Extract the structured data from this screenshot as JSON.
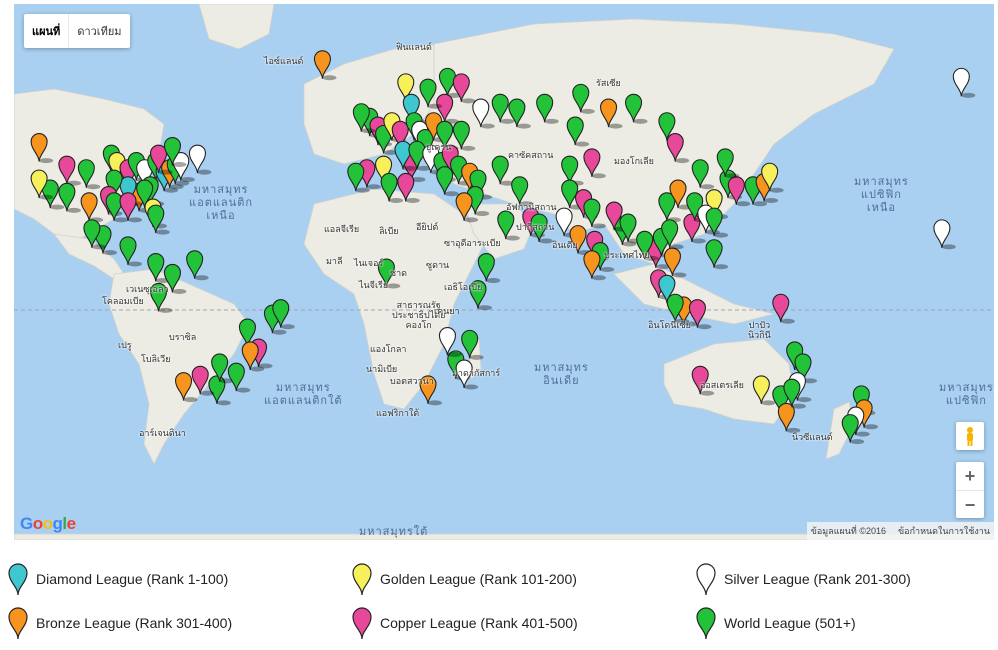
{
  "map_controls": {
    "map_type_map": "แผนที่",
    "map_type_satellite": "ดาวเทียม",
    "zoom_in": "+",
    "zoom_out": "−"
  },
  "branding": {
    "google_logo": "Google",
    "attribution": "ข้อมูลแผนที่ ©2016",
    "terms": "ข้อกำหนดในการใช้งาน"
  },
  "ocean_labels": {
    "north_atlantic": "มหาสมุทร\nแอตแลนติก\nเหนือ",
    "south_atlantic": "มหาสมุทร\nแอตแลนติกใต้",
    "north_pacific": "มหาสมุทร\nแปซิฟิก\nเหนือ",
    "south_pacific": "มหาสมุทร\nแปซิฟิก",
    "indian": "มหาสมุทร\nอินเดีย",
    "southern": "มหาสมุทรใต้"
  },
  "place_labels": {
    "iceland": "ไอซ์แลนด์",
    "finland": "ฟินแลนด์",
    "russia": "รัสเซีย",
    "ukraine": "ยูเครน",
    "kazakhstan": "คาซัคสถาน",
    "mongolia": "มองโกเลีย",
    "afghanistan": "อัฟกานิสถาน",
    "pakistan": "ปากีสถาน",
    "india": "อินเดีย",
    "algeria": "แอลจีเรีย",
    "libya": "ลิเบีย",
    "egypt": "อียิปต์",
    "saudi": "ซาอุดีอาระเบีย",
    "mali": "มาลี",
    "niger": "ไนเจอร์",
    "chad": "ชาด",
    "sudan": "ซูดาน",
    "nigeria": "ไนจีเรีย",
    "ethiopia": "เอธิโอเปีย",
    "drc": "สาธารณรัฐ\nประชาธิปไตย\nคองโก",
    "kenya": "เคนยา",
    "angola": "แองโกลา",
    "namibia": "นามิเบีย",
    "botswana": "บอตสวานา",
    "madagascar": "มาดากัสการ์",
    "south_africa": "แอฟริกาใต้",
    "venezuela": "เวเนซุเอลา",
    "colombia": "โคลอมเบีย",
    "peru": "เปรู",
    "brazil": "บราซิล",
    "bolivia": "โบลิเวีย",
    "argentina": "อาร์เจนตินา",
    "indonesia": "อินโดนีเซีย",
    "png": "ปาปัว\nนิวกินี",
    "australia": "ออสเตรเลีย",
    "new_zealand": "นิวซีแลนด์",
    "thailand": "ประเทศไทย"
  },
  "legend": [
    {
      "label": "Diamond League (Rank 1-100)",
      "color": "#3fc7d0"
    },
    {
      "label": "Golden League (Rank 101-200)",
      "color": "#f8f05a"
    },
    {
      "label": "Silver League (Rank 201-300)",
      "color": "#ffffff"
    },
    {
      "label": "Bronze League (Rank 301-400)",
      "color": "#f7941d"
    },
    {
      "label": "Copper League (Rank 401-500)",
      "color": "#e8489a"
    },
    {
      "label": "World League (501+)",
      "color": "#22c339"
    }
  ],
  "markers": [
    {
      "lon": -96,
      "lat": 44,
      "league": 5
    },
    {
      "lon": -94,
      "lat": 42,
      "league": 1
    },
    {
      "lon": -90,
      "lat": 40,
      "league": 4
    },
    {
      "lon": -87,
      "lat": 42,
      "league": 5
    },
    {
      "lon": -84,
      "lat": 40,
      "league": 2
    },
    {
      "lon": -80,
      "lat": 42,
      "league": 5
    },
    {
      "lon": -77,
      "lat": 39,
      "league": 0
    },
    {
      "lon": -75,
      "lat": 40,
      "league": 3
    },
    {
      "lon": -73,
      "lat": 41,
      "league": 5
    },
    {
      "lon": -71,
      "lat": 42,
      "league": 2
    },
    {
      "lon": -79,
      "lat": 44,
      "league": 4
    },
    {
      "lon": -74,
      "lat": 46,
      "league": 5
    },
    {
      "lon": -65,
      "lat": 44,
      "league": 2
    },
    {
      "lon": -82,
      "lat": 35,
      "league": 5
    },
    {
      "lon": -86,
      "lat": 33,
      "league": 3
    },
    {
      "lon": -90,
      "lat": 35,
      "league": 0
    },
    {
      "lon": -95,
      "lat": 37,
      "league": 5
    },
    {
      "lon": -97,
      "lat": 32,
      "league": 4
    },
    {
      "lon": -95,
      "lat": 30,
      "league": 5
    },
    {
      "lon": -90,
      "lat": 30,
      "league": 4
    },
    {
      "lon": -84,
      "lat": 34,
      "league": 5
    },
    {
      "lon": -81,
      "lat": 28,
      "league": 1
    },
    {
      "lon": -80,
      "lat": 26,
      "league": 5
    },
    {
      "lon": -105,
      "lat": 40,
      "league": 5
    },
    {
      "lon": -112,
      "lat": 41,
      "league": 4
    },
    {
      "lon": -118,
      "lat": 34,
      "league": 5
    },
    {
      "lon": -122,
      "lat": 37,
      "league": 1
    },
    {
      "lon": -122,
      "lat": 47,
      "league": 3
    },
    {
      "lon": -112,
      "lat": 33,
      "league": 5
    },
    {
      "lon": -104,
      "lat": 30,
      "league": 3
    },
    {
      "lon": -99,
      "lat": 19,
      "league": 5
    },
    {
      "lon": -103,
      "lat": 21,
      "league": 5
    },
    {
      "lon": -90,
      "lat": 15,
      "league": 5
    },
    {
      "lon": -80,
      "lat": 9,
      "league": 5
    },
    {
      "lon": -74,
      "lat": 5,
      "league": 5
    },
    {
      "lon": -66,
      "lat": 10,
      "league": 5
    },
    {
      "lon": -79,
      "lat": -2,
      "league": 5
    },
    {
      "lon": -47,
      "lat": -15,
      "league": 5
    },
    {
      "lon": -43,
      "lat": -22,
      "league": 4
    },
    {
      "lon": -46,
      "lat": -23,
      "league": 3
    },
    {
      "lon": -38,
      "lat": -10,
      "league": 5
    },
    {
      "lon": -58,
      "lat": -34,
      "league": 5
    },
    {
      "lon": -64,
      "lat": -31,
      "league": 4
    },
    {
      "lon": -70,
      "lat": -33,
      "league": 3
    },
    {
      "lon": -57,
      "lat": -27,
      "league": 5
    },
    {
      "lon": -51,
      "lat": -30,
      "league": 5
    },
    {
      "lon": -35,
      "lat": -8,
      "league": 5
    },
    {
      "lon": -20,
      "lat": 64,
      "league": 3
    },
    {
      "lon": 10,
      "lat": 60,
      "league": 1
    },
    {
      "lon": 25,
      "lat": 61,
      "league": 5
    },
    {
      "lon": 24,
      "lat": 56,
      "league": 4
    },
    {
      "lon": 18,
      "lat": 59,
      "league": 5
    },
    {
      "lon": 12,
      "lat": 56,
      "league": 0
    },
    {
      "lon": -3,
      "lat": 53,
      "league": 5
    },
    {
      "lon": 0,
      "lat": 51,
      "league": 4
    },
    {
      "lon": -6,
      "lat": 54,
      "league": 5
    },
    {
      "lon": 2,
      "lat": 49,
      "league": 5
    },
    {
      "lon": 5,
      "lat": 52,
      "league": 1
    },
    {
      "lon": 8,
      "lat": 50,
      "league": 4
    },
    {
      "lon": 13,
      "lat": 52,
      "league": 5
    },
    {
      "lon": 15,
      "lat": 50,
      "league": 2
    },
    {
      "lon": 17,
      "lat": 48,
      "league": 5
    },
    {
      "lon": 20,
      "lat": 52,
      "league": 3
    },
    {
      "lon": 24,
      "lat": 50,
      "league": 5
    },
    {
      "lon": 30,
      "lat": 50,
      "league": 5
    },
    {
      "lon": 37,
      "lat": 55,
      "league": 2
    },
    {
      "lon": 44,
      "lat": 56,
      "league": 5
    },
    {
      "lon": 50,
      "lat": 55,
      "league": 5
    },
    {
      "lon": 60,
      "lat": 56,
      "league": 5
    },
    {
      "lon": 30,
      "lat": 60,
      "league": 4
    },
    {
      "lon": -4,
      "lat": 40,
      "league": 4
    },
    {
      "lon": -8,
      "lat": 39,
      "league": 5
    },
    {
      "lon": 2,
      "lat": 41,
      "league": 1
    },
    {
      "lon": 12,
      "lat": 42,
      "league": 4
    },
    {
      "lon": 9,
      "lat": 45,
      "league": 0
    },
    {
      "lon": 14,
      "lat": 45,
      "league": 5
    },
    {
      "lon": 19,
      "lat": 44,
      "league": 2
    },
    {
      "lon": 23,
      "lat": 42,
      "league": 5
    },
    {
      "lon": 26,
      "lat": 44,
      "league": 4
    },
    {
      "lon": 24,
      "lat": 38,
      "league": 5
    },
    {
      "lon": 29,
      "lat": 41,
      "league": 5
    },
    {
      "lon": 33,
      "lat": 39,
      "league": 3
    },
    {
      "lon": 36,
      "lat": 37,
      "league": 5
    },
    {
      "lon": 35,
      "lat": 32,
      "league": 5
    },
    {
      "lon": 31,
      "lat": 30,
      "league": 3
    },
    {
      "lon": 44,
      "lat": 41,
      "league": 5
    },
    {
      "lon": 46,
      "lat": 24,
      "league": 5
    },
    {
      "lon": 51,
      "lat": 35,
      "league": 5
    },
    {
      "lon": 55,
      "lat": 25,
      "league": 4
    },
    {
      "lon": 58,
      "lat": 23,
      "league": 5
    },
    {
      "lon": 69,
      "lat": 41,
      "league": 5
    },
    {
      "lon": 71,
      "lat": 51,
      "league": 5
    },
    {
      "lon": 77,
      "lat": 43,
      "league": 4
    },
    {
      "lon": 69,
      "lat": 34,
      "league": 5
    },
    {
      "lon": 67,
      "lat": 25,
      "league": 2
    },
    {
      "lon": 74,
      "lat": 31,
      "league": 4
    },
    {
      "lon": 77,
      "lat": 28,
      "league": 5
    },
    {
      "lon": 72,
      "lat": 19,
      "league": 3
    },
    {
      "lon": 78,
      "lat": 17,
      "league": 4
    },
    {
      "lon": 80,
      "lat": 13,
      "league": 5
    },
    {
      "lon": 77,
      "lat": 10,
      "league": 3
    },
    {
      "lon": 88,
      "lat": 22,
      "league": 5
    },
    {
      "lon": 85,
      "lat": 27,
      "league": 4
    },
    {
      "lon": 90,
      "lat": 23,
      "league": 5
    },
    {
      "lon": 73,
      "lat": 58,
      "league": 5
    },
    {
      "lon": 83,
      "lat": 55,
      "league": 3
    },
    {
      "lon": 92,
      "lat": 56,
      "league": 5
    },
    {
      "lon": 104,
      "lat": 52,
      "league": 5
    },
    {
      "lon": 107,
      "lat": 47,
      "league": 4
    },
    {
      "lon": 116,
      "lat": 40,
      "league": 5
    },
    {
      "lon": 121,
      "lat": 31,
      "league": 1
    },
    {
      "lon": 113,
      "lat": 23,
      "league": 4
    },
    {
      "lon": 104,
      "lat": 30,
      "league": 5
    },
    {
      "lon": 108,
      "lat": 34,
      "league": 3
    },
    {
      "lon": 114,
      "lat": 30,
      "league": 5
    },
    {
      "lon": 118,
      "lat": 26,
      "league": 2
    },
    {
      "lon": 126,
      "lat": 37,
      "league": 5
    },
    {
      "lon": 129,
      "lat": 35,
      "league": 4
    },
    {
      "lon": 135,
      "lat": 35,
      "league": 5
    },
    {
      "lon": 139,
      "lat": 36,
      "league": 3
    },
    {
      "lon": 141,
      "lat": 39,
      "league": 1
    },
    {
      "lon": 125,
      "lat": 43,
      "league": 5
    },
    {
      "lon": 121,
      "lat": 25,
      "league": 5
    },
    {
      "lon": 100,
      "lat": 14,
      "league": 4
    },
    {
      "lon": 102,
      "lat": 18,
      "league": 5
    },
    {
      "lon": 106,
      "lat": 11,
      "league": 3
    },
    {
      "lon": 105,
      "lat": 21,
      "league": 5
    },
    {
      "lon": 101,
      "lat": 3,
      "league": 4
    },
    {
      "lon": 104,
      "lat": 1,
      "league": 0
    },
    {
      "lon": 96,
      "lat": 17,
      "league": 5
    },
    {
      "lon": 121,
      "lat": 14,
      "league": 5
    },
    {
      "lon": 110,
      "lat": -7,
      "league": 3
    },
    {
      "lon": 107,
      "lat": -6,
      "league": 5
    },
    {
      "lon": 115,
      "lat": -8,
      "league": 4
    },
    {
      "lon": 145,
      "lat": -6,
      "league": 4
    },
    {
      "lon": 150,
      "lat": -23,
      "league": 5
    },
    {
      "lon": 153,
      "lat": -27,
      "league": 5
    },
    {
      "lon": 151,
      "lat": -33,
      "league": 2
    },
    {
      "lon": 145,
      "lat": -37,
      "league": 5
    },
    {
      "lon": 138,
      "lat": -34,
      "league": 1
    },
    {
      "lon": 147,
      "lat": -42,
      "league": 3
    },
    {
      "lon": 116,
      "lat": -31,
      "league": 4
    },
    {
      "lon": 149,
      "lat": -35,
      "league": 5
    },
    {
      "lon": 174,
      "lat": -37,
      "league": 5
    },
    {
      "lon": 175,
      "lat": -41,
      "league": 3
    },
    {
      "lon": 172,
      "lat": -43,
      "league": 2
    },
    {
      "lon": 170,
      "lat": -45,
      "league": 5
    },
    {
      "lon": -150,
      "lat": 61,
      "league": 2
    },
    {
      "lon": -157,
      "lat": 21,
      "league": 2
    },
    {
      "lon": 4,
      "lat": 36,
      "league": 5
    },
    {
      "lon": 10,
      "lat": 36,
      "league": 4
    },
    {
      "lon": 3,
      "lat": 7,
      "league": 5
    },
    {
      "lon": 36,
      "lat": -1,
      "league": 5
    },
    {
      "lon": 39,
      "lat": 9,
      "league": 5
    },
    {
      "lon": 28,
      "lat": -26,
      "league": 5
    },
    {
      "lon": 18,
      "lat": -34,
      "league": 3
    },
    {
      "lon": 31,
      "lat": -29,
      "league": 2
    },
    {
      "lon": 25,
      "lat": -18,
      "league": 2
    },
    {
      "lon": 33,
      "lat": -19,
      "league": 5
    }
  ]
}
